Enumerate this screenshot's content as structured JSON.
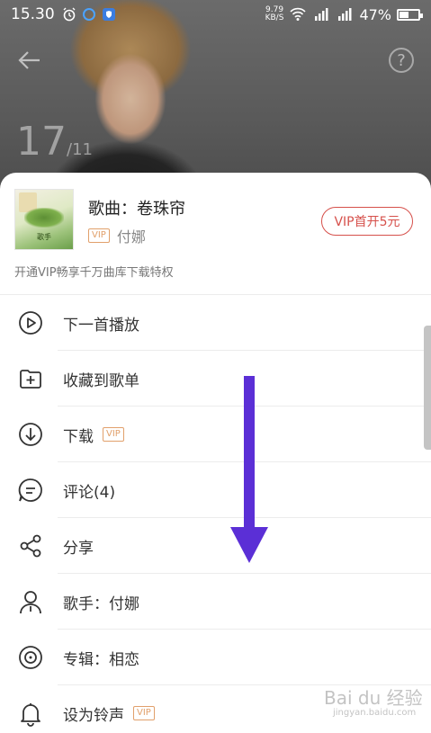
{
  "status_bar": {
    "time": "15.30",
    "net_speed": "9.79",
    "net_unit": "KB/S",
    "battery": "47%",
    "battery_level": 0.47
  },
  "hero": {
    "page_current": "17",
    "page_total": "/11"
  },
  "song": {
    "title": "歌曲：卷珠帘",
    "vip_badge": "VIP",
    "artist": "付娜",
    "vip_button": "VIP首开5元",
    "promo": "开通VIP畅享千万曲库下载特权",
    "cover_text": "歌手"
  },
  "menu": [
    {
      "label": "下一首播放",
      "icon": "play-next-icon",
      "vip": ""
    },
    {
      "label": "收藏到歌单",
      "icon": "add-to-playlist-icon",
      "vip": ""
    },
    {
      "label": "下载",
      "icon": "download-icon",
      "vip": "VIP"
    },
    {
      "label": "评论(4)",
      "icon": "comment-icon",
      "vip": ""
    },
    {
      "label": "分享",
      "icon": "share-icon",
      "vip": ""
    },
    {
      "label": "歌手：付娜",
      "icon": "singer-icon",
      "vip": ""
    },
    {
      "label": "专辑：相恋",
      "icon": "album-icon",
      "vip": ""
    },
    {
      "label": "设为铃声",
      "icon": "bell-icon",
      "vip": "VIP"
    }
  ],
  "watermark": {
    "text": "Bai du 经验",
    "sub": "jingyan.baidu.com"
  },
  "colors": {
    "accent_red": "#d6504b",
    "vip_orange": "#e1a06b",
    "arrow_purple": "#5b2fd6"
  }
}
